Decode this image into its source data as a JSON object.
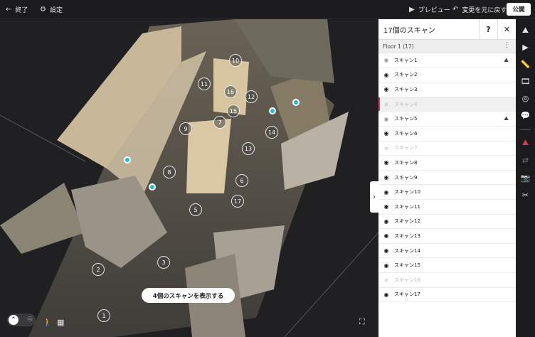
{
  "topbar": {
    "exit_label": "終了",
    "settings_label": "設定",
    "preview_label": "プレビュー",
    "undo_label": "変更を元に戻す",
    "publish_label": "公開"
  },
  "viewport": {
    "markers": [
      "1",
      "2",
      "3",
      "5",
      "6",
      "7",
      "8",
      "9",
      "10",
      "11",
      "12",
      "13",
      "14",
      "15",
      "16",
      "17"
    ],
    "show_scans_label": "4個のスキャンを表示する",
    "accent_color": "#19c0d8"
  },
  "panel": {
    "title": "17個のスキャン",
    "help_label": "?",
    "close_label": "✕",
    "floor_label": "Floor 1  (17)",
    "scans": [
      "スキャン1",
      "スキャン2",
      "スキャン3",
      "スキャン4",
      "スキャン5",
      "スキャン6",
      "スキャン7",
      "スキャン8",
      "スキャン9",
      "スキャン10",
      "スキャン11",
      "スキャン12",
      "スキャン13",
      "スキャン14",
      "スキャン15",
      "スキャン16",
      "スキャン17"
    ],
    "selected_color": "#e23a55"
  }
}
